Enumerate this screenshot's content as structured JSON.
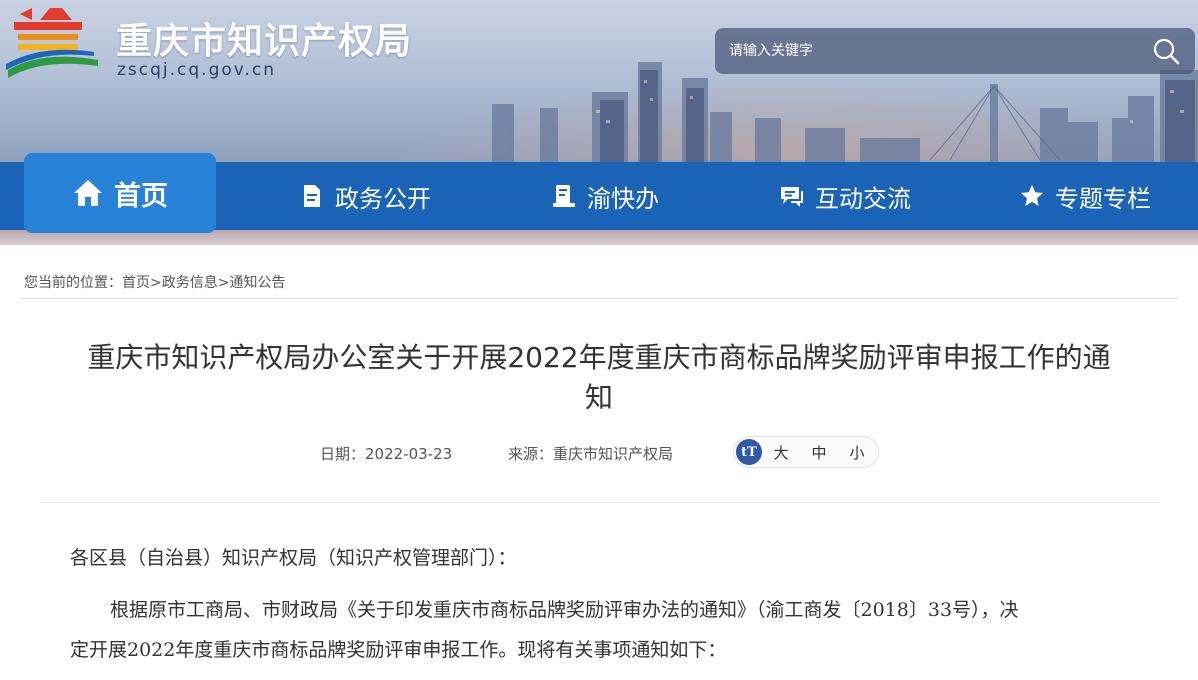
{
  "header": {
    "site_title": "重庆市知识产权局",
    "site_domain": "zscqj.cq.gov.cn",
    "search_placeholder": "请输入关键字"
  },
  "nav": {
    "items": [
      {
        "label": "首页",
        "icon": "home-icon",
        "active": true
      },
      {
        "label": "政务公开",
        "icon": "document-icon"
      },
      {
        "label": "渝快办",
        "icon": "service-icon"
      },
      {
        "label": "互动交流",
        "icon": "chat-icon"
      },
      {
        "label": "专题专栏",
        "icon": "star-icon"
      }
    ]
  },
  "breadcrumb": {
    "prefix": "您当前的位置：",
    "items": [
      "首页",
      "政务信息",
      "通知公告"
    ],
    "separator": ">"
  },
  "article": {
    "title_line1": "重庆市知识产权局办公室关于开展2022年度重庆市商标品牌奖励评审申报工作的通",
    "title_line2": "知",
    "date_label": "日期：2022-03-23",
    "source_label": "来源：重庆市知识产权局",
    "font_controls": {
      "icon_text": "tT",
      "large": "大",
      "medium": "中",
      "small": "小"
    },
    "salutation": "各区县（自治县）知识产权局（知识产权管理部门）：",
    "body_line1": "根据原市工商局、市财政局《关于印发重庆市商标品牌奖励评审办法的通知》（渝工商发〔2018〕33号），决",
    "body_line2": "定开展2022年度重庆市商标品牌奖励评审申报工作。现将有关事项通知如下："
  },
  "colors": {
    "nav_bg": "#1a63b7",
    "nav_active": "#2882d8",
    "font_icon_bg": "#2f58a7"
  }
}
